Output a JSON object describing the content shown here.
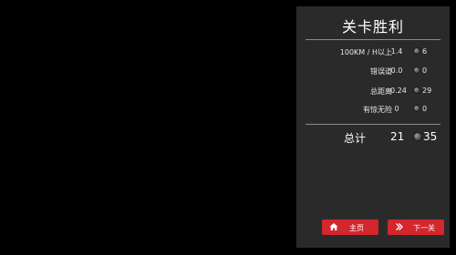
{
  "panel": {
    "title": "关卡胜利",
    "rows": [
      {
        "label": "100KM / H以上",
        "value": "1.4",
        "score": "6"
      },
      {
        "label": "错误道",
        "value": "0.0",
        "score": "0"
      },
      {
        "label": "总距离",
        "value": "0.24",
        "score": "29"
      },
      {
        "label": "有惊无险",
        "value": "0",
        "score": "0"
      }
    ],
    "total": {
      "label": "总计",
      "value": "21",
      "score": "35"
    }
  },
  "buttons": {
    "home_label": "主页",
    "next_label": "下一关",
    "home_icon": "home-icon",
    "next_icon": "double-chevron-right-icon"
  },
  "colors": {
    "panel_bg": "#2a2a2a",
    "button_red": "#d3262d",
    "background": "#000000"
  }
}
